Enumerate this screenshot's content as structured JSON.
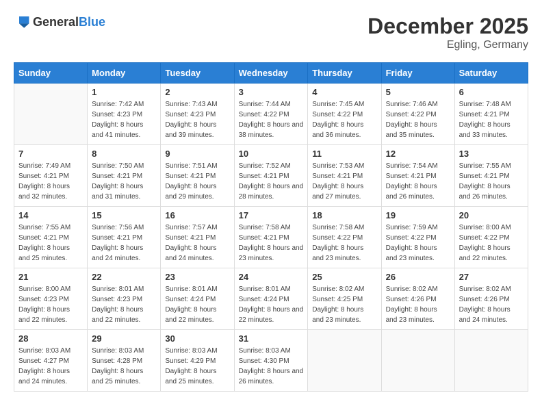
{
  "header": {
    "logo_general": "General",
    "logo_blue": "Blue",
    "month_title": "December 2025",
    "location": "Egling, Germany"
  },
  "days_of_week": [
    "Sunday",
    "Monday",
    "Tuesday",
    "Wednesday",
    "Thursday",
    "Friday",
    "Saturday"
  ],
  "weeks": [
    [
      {
        "day": "",
        "sunrise": "",
        "sunset": "",
        "daylight": ""
      },
      {
        "day": "1",
        "sunrise": "7:42 AM",
        "sunset": "4:23 PM",
        "daylight": "8 hours and 41 minutes."
      },
      {
        "day": "2",
        "sunrise": "7:43 AM",
        "sunset": "4:23 PM",
        "daylight": "8 hours and 39 minutes."
      },
      {
        "day": "3",
        "sunrise": "7:44 AM",
        "sunset": "4:22 PM",
        "daylight": "8 hours and 38 minutes."
      },
      {
        "day": "4",
        "sunrise": "7:45 AM",
        "sunset": "4:22 PM",
        "daylight": "8 hours and 36 minutes."
      },
      {
        "day": "5",
        "sunrise": "7:46 AM",
        "sunset": "4:22 PM",
        "daylight": "8 hours and 35 minutes."
      },
      {
        "day": "6",
        "sunrise": "7:48 AM",
        "sunset": "4:21 PM",
        "daylight": "8 hours and 33 minutes."
      }
    ],
    [
      {
        "day": "7",
        "sunrise": "7:49 AM",
        "sunset": "4:21 PM",
        "daylight": "8 hours and 32 minutes."
      },
      {
        "day": "8",
        "sunrise": "7:50 AM",
        "sunset": "4:21 PM",
        "daylight": "8 hours and 31 minutes."
      },
      {
        "day": "9",
        "sunrise": "7:51 AM",
        "sunset": "4:21 PM",
        "daylight": "8 hours and 29 minutes."
      },
      {
        "day": "10",
        "sunrise": "7:52 AM",
        "sunset": "4:21 PM",
        "daylight": "8 hours and 28 minutes."
      },
      {
        "day": "11",
        "sunrise": "7:53 AM",
        "sunset": "4:21 PM",
        "daylight": "8 hours and 27 minutes."
      },
      {
        "day": "12",
        "sunrise": "7:54 AM",
        "sunset": "4:21 PM",
        "daylight": "8 hours and 26 minutes."
      },
      {
        "day": "13",
        "sunrise": "7:55 AM",
        "sunset": "4:21 PM",
        "daylight": "8 hours and 26 minutes."
      }
    ],
    [
      {
        "day": "14",
        "sunrise": "7:55 AM",
        "sunset": "4:21 PM",
        "daylight": "8 hours and 25 minutes."
      },
      {
        "day": "15",
        "sunrise": "7:56 AM",
        "sunset": "4:21 PM",
        "daylight": "8 hours and 24 minutes."
      },
      {
        "day": "16",
        "sunrise": "7:57 AM",
        "sunset": "4:21 PM",
        "daylight": "8 hours and 24 minutes."
      },
      {
        "day": "17",
        "sunrise": "7:58 AM",
        "sunset": "4:21 PM",
        "daylight": "8 hours and 23 minutes."
      },
      {
        "day": "18",
        "sunrise": "7:58 AM",
        "sunset": "4:22 PM",
        "daylight": "8 hours and 23 minutes."
      },
      {
        "day": "19",
        "sunrise": "7:59 AM",
        "sunset": "4:22 PM",
        "daylight": "8 hours and 23 minutes."
      },
      {
        "day": "20",
        "sunrise": "8:00 AM",
        "sunset": "4:22 PM",
        "daylight": "8 hours and 22 minutes."
      }
    ],
    [
      {
        "day": "21",
        "sunrise": "8:00 AM",
        "sunset": "4:23 PM",
        "daylight": "8 hours and 22 minutes."
      },
      {
        "day": "22",
        "sunrise": "8:01 AM",
        "sunset": "4:23 PM",
        "daylight": "8 hours and 22 minutes."
      },
      {
        "day": "23",
        "sunrise": "8:01 AM",
        "sunset": "4:24 PM",
        "daylight": "8 hours and 22 minutes."
      },
      {
        "day": "24",
        "sunrise": "8:01 AM",
        "sunset": "4:24 PM",
        "daylight": "8 hours and 22 minutes."
      },
      {
        "day": "25",
        "sunrise": "8:02 AM",
        "sunset": "4:25 PM",
        "daylight": "8 hours and 23 minutes."
      },
      {
        "day": "26",
        "sunrise": "8:02 AM",
        "sunset": "4:26 PM",
        "daylight": "8 hours and 23 minutes."
      },
      {
        "day": "27",
        "sunrise": "8:02 AM",
        "sunset": "4:26 PM",
        "daylight": "8 hours and 24 minutes."
      }
    ],
    [
      {
        "day": "28",
        "sunrise": "8:03 AM",
        "sunset": "4:27 PM",
        "daylight": "8 hours and 24 minutes."
      },
      {
        "day": "29",
        "sunrise": "8:03 AM",
        "sunset": "4:28 PM",
        "daylight": "8 hours and 25 minutes."
      },
      {
        "day": "30",
        "sunrise": "8:03 AM",
        "sunset": "4:29 PM",
        "daylight": "8 hours and 25 minutes."
      },
      {
        "day": "31",
        "sunrise": "8:03 AM",
        "sunset": "4:30 PM",
        "daylight": "8 hours and 26 minutes."
      },
      {
        "day": "",
        "sunrise": "",
        "sunset": "",
        "daylight": ""
      },
      {
        "day": "",
        "sunrise": "",
        "sunset": "",
        "daylight": ""
      },
      {
        "day": "",
        "sunrise": "",
        "sunset": "",
        "daylight": ""
      }
    ]
  ]
}
